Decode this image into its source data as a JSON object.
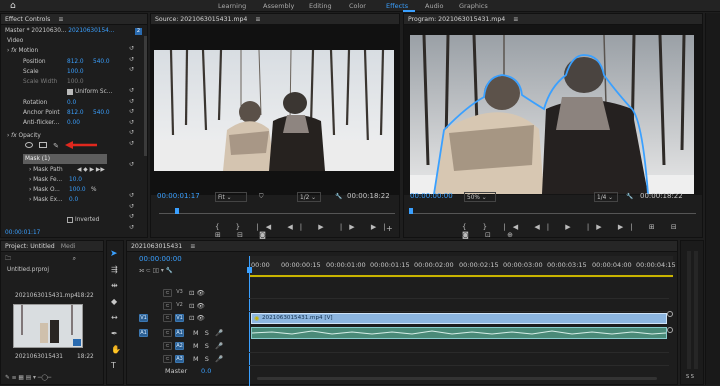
{
  "workspaces": [
    "Learning",
    "Assembly",
    "Editing",
    "Color",
    "Effects",
    "Audio",
    "Graphics"
  ],
  "active_workspace": "Effects",
  "effect_controls": {
    "tab": "Effect Controls",
    "master": "Master * 20210630...",
    "clip": "20210630154...",
    "section_video": "Video",
    "motion": "Motion",
    "position_label": "Position",
    "position_x": "812.0",
    "position_y": "540.0",
    "scale_label": "Scale",
    "scale_value": "100.0",
    "scale_width_label": "Scale Width",
    "scale_width_value": "100.0",
    "uniform_scale": "Uniform Sc...",
    "rotation_label": "Rotation",
    "rotation_value": "0.0",
    "anchor_label": "Anchor Point",
    "anchor_x": "812.0",
    "anchor_y": "540.0",
    "antiflicker_label": "Anti-flicker...",
    "antiflicker_value": "0.00",
    "opacity": "Opacity",
    "mask": "Mask (1)",
    "mask_path": "Mask Path",
    "mask_feather": "Mask Fe...",
    "mask_feather_value": "10.0",
    "mask_opacity": "Mask O...",
    "mask_opacity_value": "100.0",
    "mask_opacity_unit": "%",
    "mask_expansion": "Mask Ex...",
    "mask_expansion_value": "0.0",
    "inverted": "Inverted",
    "time": "00:00:01:17",
    "marker": "2"
  },
  "source": {
    "tab": "Source: 2021063015431.mp4",
    "timecode": "00:00:01:17",
    "fit": "Fit",
    "quality": "1/2",
    "duration": "00:00:18:22"
  },
  "program": {
    "tab": "Program: 2021063015431.mp4",
    "timecode": "00:00:00:00",
    "zoom": "50%",
    "quality": "1/4",
    "duration": "00:00:18:22"
  },
  "project": {
    "tab": "Project: Untitled",
    "tab2": "Medi",
    "file": "Untitled.prproj",
    "clip_name": "2021063015431.mp4",
    "clip_dur": "18:22",
    "seq_name": "2021063015431",
    "seq_dur": "18:22"
  },
  "timeline": {
    "tab": "2021063015431",
    "timecode": "00:00:00:00",
    "ruler": [
      "00:00",
      "00:00:00:15",
      "00:00:01:00",
      "00:00:01:15",
      "00:00:02:00",
      "00:00:02:15",
      "00:00:03:00",
      "00:00:03:15",
      "00:00:04:00",
      "00:00:04:15"
    ],
    "video_tracks": [
      "V3",
      "V2",
      "V1"
    ],
    "audio_tracks": [
      "A1",
      "A2",
      "A3"
    ],
    "src_v": "V1",
    "src_a": "A1",
    "clip_label": "2021063015431.mp4 [V]",
    "master": "Master",
    "master_value": "0.0"
  },
  "audio_meter": {
    "scale": "S S"
  }
}
